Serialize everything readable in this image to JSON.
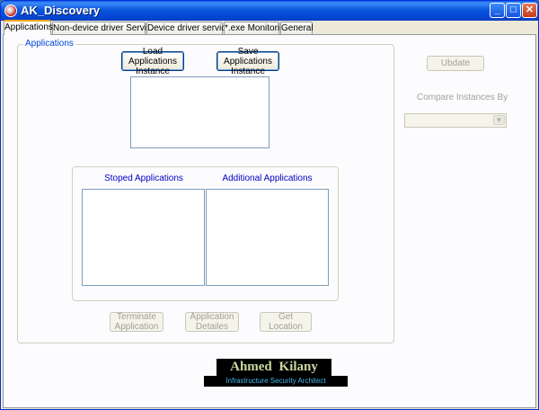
{
  "window": {
    "title": "AK_Discovery",
    "minimize_glyph": "_",
    "maximize_glyph": "□",
    "close_glyph": "✕"
  },
  "tabs": [
    {
      "label": "Applications",
      "active": true
    },
    {
      "label": "Non-device driver Services",
      "active": false
    },
    {
      "label": "Device driver services",
      "active": false
    },
    {
      "label": "*.exe Monitoring",
      "active": false
    },
    {
      "label": "General",
      "active": false
    }
  ],
  "applications_group": {
    "legend": "Applications",
    "load_button": "Load Applications Instance",
    "save_button": "Save Applications Instance",
    "stopped_label": "Stoped Applications",
    "additional_label": "Additional Applications",
    "terminate_button": "Terminate Application",
    "details_button": "Application Detailes",
    "location_button": "Get Location"
  },
  "right_panel": {
    "update_button": "Ubdate",
    "compare_label": "Compare Instances By",
    "compare_value": "",
    "dropdown_glyph": "▼"
  },
  "banner": {
    "name": "Ahmed Kilany",
    "subtitle": "Infrastructure Security Architect"
  },
  "colors": {
    "titlebar": "#0a57e0",
    "face": "#ece9d8",
    "panel": "#fcfcfe",
    "legend_text": "#0046d5",
    "column_label": "#0000c0",
    "banner_name": "#c8d8a0",
    "banner_subtitle": "#40b8e8"
  }
}
